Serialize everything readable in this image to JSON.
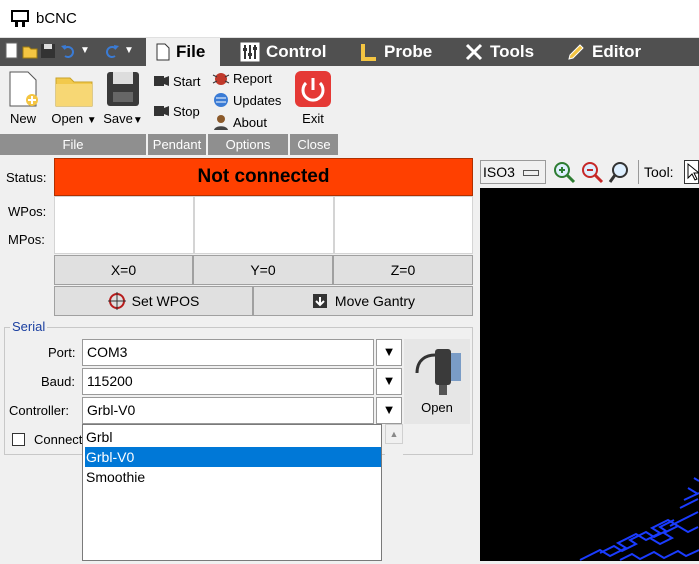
{
  "window": {
    "title": "bCNC"
  },
  "tabs": [
    {
      "label": "File",
      "icon": "file-icon"
    },
    {
      "label": "Control",
      "icon": "control-icon"
    },
    {
      "label": "Probe",
      "icon": "probe-icon"
    },
    {
      "label": "Tools",
      "icon": "tools-icon"
    },
    {
      "label": "Editor",
      "icon": "editor-icon"
    }
  ],
  "ribbon": {
    "file": {
      "new": "New",
      "open": "Open",
      "save": "Save",
      "group": "File"
    },
    "pendant": {
      "start": "Start",
      "stop": "Stop",
      "group": "Pendant"
    },
    "options": {
      "report": "Report",
      "updates": "Updates",
      "about": "About",
      "group": "Options"
    },
    "close": {
      "exit": "Exit",
      "group": "Close"
    }
  },
  "status": {
    "label": "Status:",
    "value": "Not connected"
  },
  "positions": {
    "wpos_label": "WPos:",
    "mpos_label": "MPos:"
  },
  "zero_buttons": [
    "X=0",
    "Y=0",
    "Z=0"
  ],
  "actions": {
    "set_wpos": "Set WPOS",
    "move_gantry": "Move Gantry"
  },
  "serial": {
    "title": "Serial",
    "port_label": "Port:",
    "port_value": "COM3",
    "baud_label": "Baud:",
    "baud_value": "115200",
    "controller_label": "Controller:",
    "controller_value": "Grbl-V0",
    "connect_label": "Connect on startup",
    "open_label": "Open",
    "dropdown_options": [
      "Grbl",
      "Grbl-V0",
      "Smoothie"
    ],
    "selected_option": "Grbl-V0"
  },
  "canvas_toolbar": {
    "view": "ISO3",
    "tool_label": "Tool:"
  },
  "colors": {
    "status_bg": "#ff4000",
    "tab_bar": "#505050",
    "selection": "#0078d7",
    "group_label": "#8f8f8f"
  }
}
